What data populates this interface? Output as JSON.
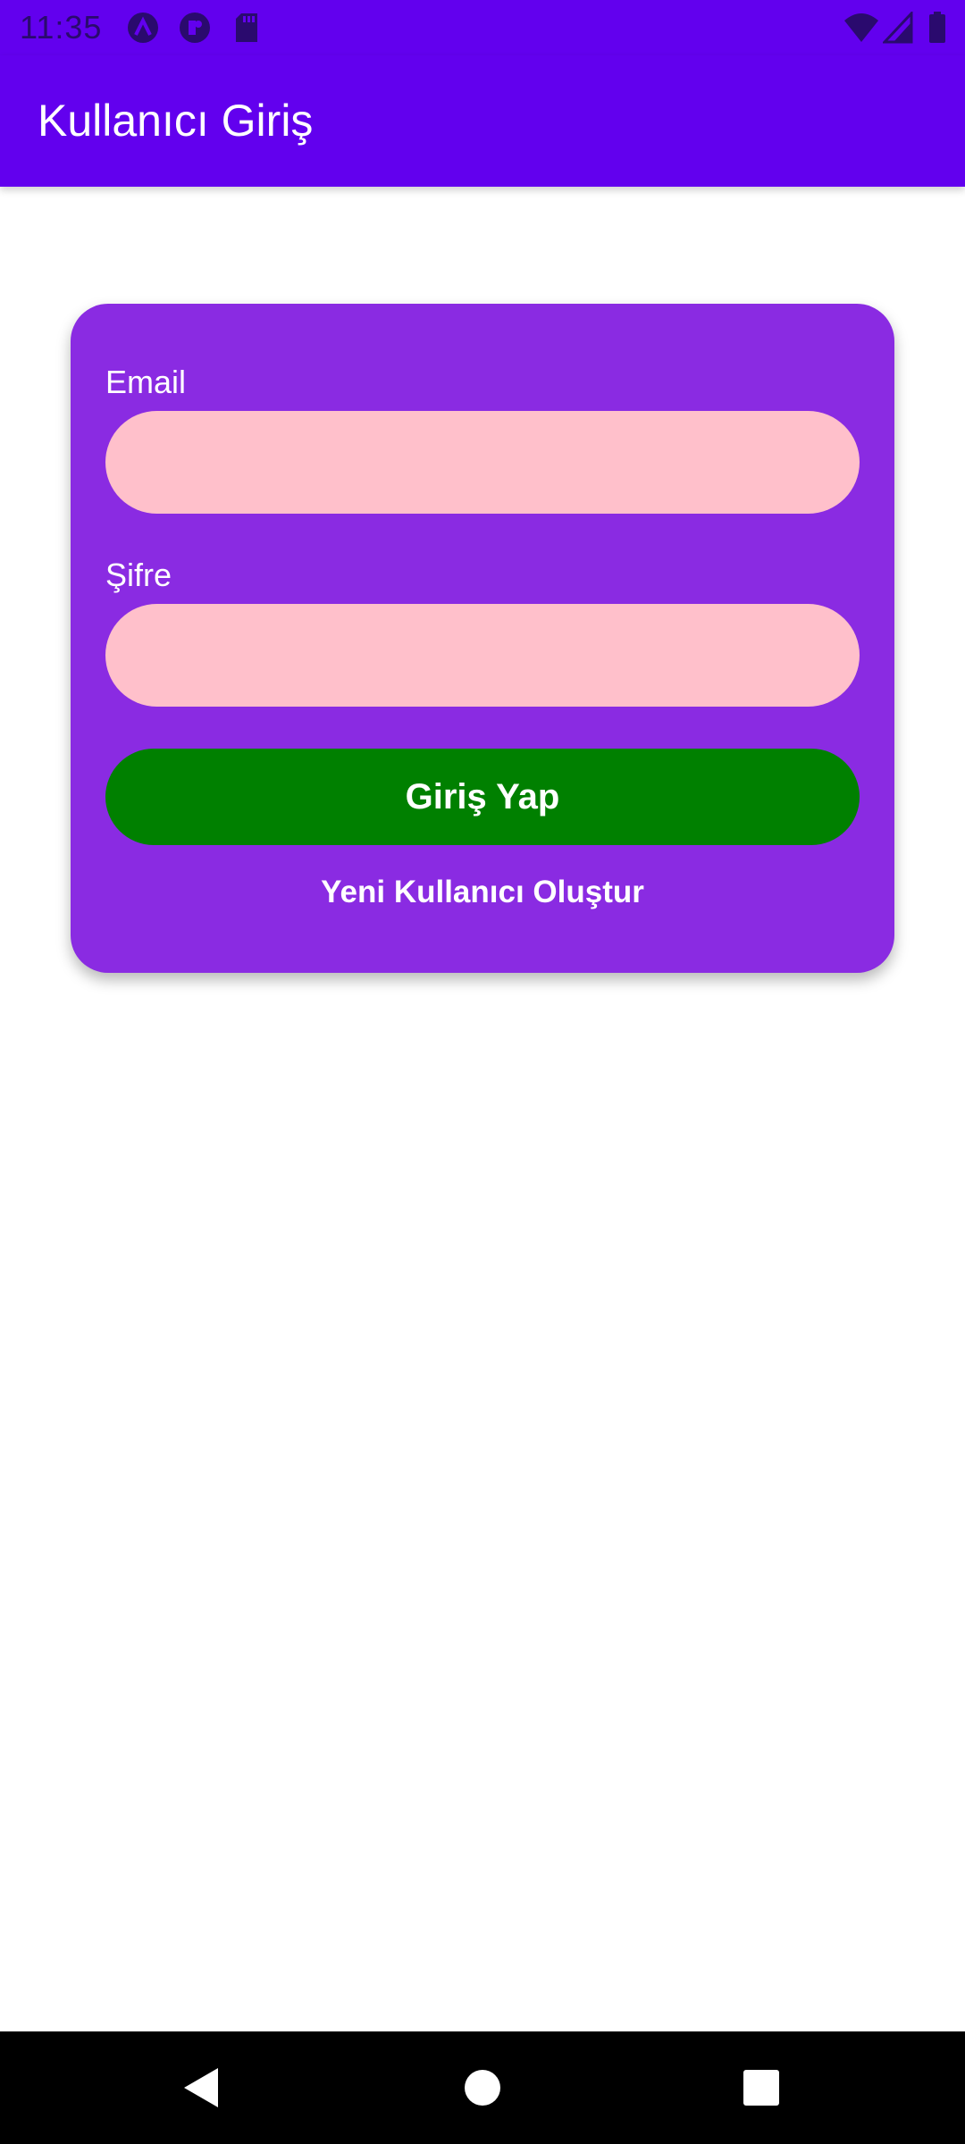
{
  "status_bar": {
    "time": "11:35",
    "icons": [
      "android-studio-icon",
      "app-notification-icon",
      "sd-card-icon",
      "wifi-icon",
      "signal-icon",
      "battery-icon"
    ]
  },
  "app_bar": {
    "title": "Kullanıcı Giriş"
  },
  "login_form": {
    "email_label": "Email",
    "email_value": "",
    "password_label": "Şifre",
    "password_value": "",
    "login_button_label": "Giriş Yap",
    "create_user_label": "Yeni Kullanıcı Oluştur"
  },
  "colors": {
    "app_bar": "#6200ee",
    "card": "#8a2be2",
    "input_fill": "#ffc0cb",
    "login_button": "#008000",
    "text_on_color": "#ffffff"
  },
  "nav_bar": {
    "icons": [
      "back-icon",
      "home-icon",
      "recents-icon"
    ]
  }
}
